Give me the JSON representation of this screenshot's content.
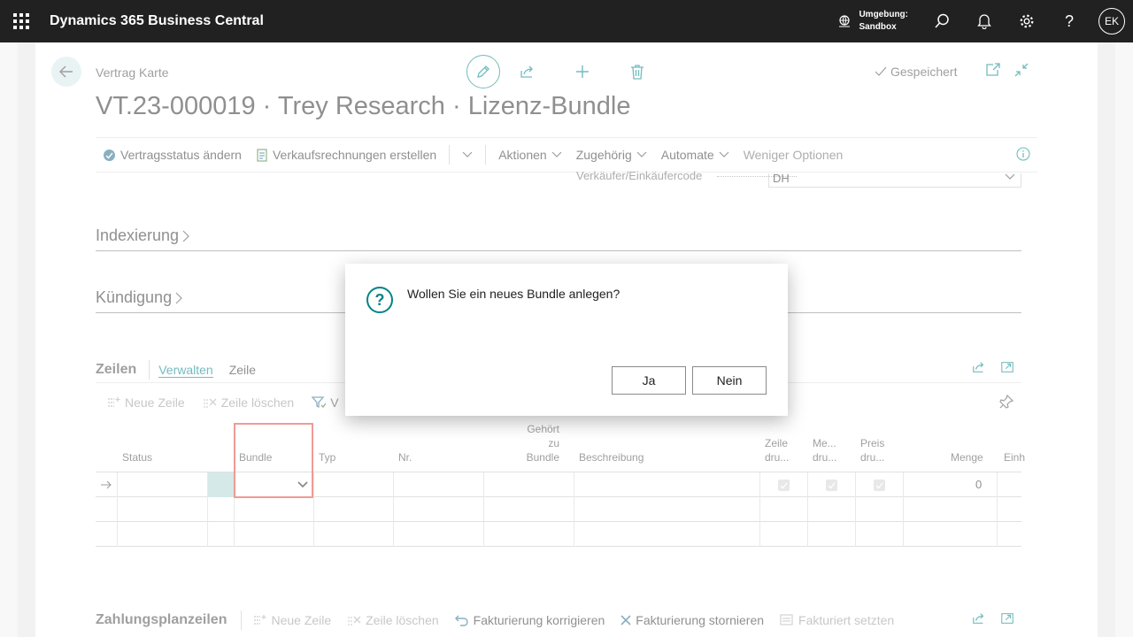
{
  "topbar": {
    "app_title": "Dynamics 365 Business Central",
    "env_label": "Umgebung:",
    "env_value": "Sandbox",
    "avatar_initials": "EK",
    "help_label": "?"
  },
  "header": {
    "breadcrumb": "Vertrag Karte",
    "saved_status": "Gespeichert",
    "title": "VT.23-000019 · Trey Research · Lizenz-Bundle"
  },
  "actionbar": {
    "change_status": "Vertragsstatus ändern",
    "create_invoices": "Verkaufsrechnungen erstellen",
    "actions": "Aktionen",
    "related": "Zugehörig",
    "automate": "Automate",
    "fewer_options": "Weniger Optionen"
  },
  "behind_field": {
    "label": "Verkäufer/Einkäufercode",
    "value": "DH"
  },
  "sections": {
    "indexing": "Indexierung",
    "termination": "Kündigung"
  },
  "lines": {
    "title": "Zeilen",
    "tab_manage": "Verwalten",
    "tab_line": "Zeile",
    "new_line": "Neue Zeile",
    "delete_line": "Zeile löschen",
    "partial_action": "V",
    "columns": {
      "status": "Status",
      "bundle": "Bundle",
      "type": "Typ",
      "no": "Nr.",
      "belongs_to_bundle_1": "Gehört zu",
      "belongs_to_bundle_2": "Bundle",
      "description": "Beschreibung",
      "line_print_1": "Zeile",
      "line_print_2": "dru...",
      "qty_print_1": "Me...",
      "qty_print_2": "dru...",
      "price_print_1": "Preis",
      "price_print_2": "dru...",
      "quantity": "Menge",
      "unit": "Einh"
    },
    "row1_quantity": "0"
  },
  "payment_plan": {
    "title": "Zahlungsplanzeilen",
    "new_line": "Neue Zeile",
    "delete_line": "Zeile löschen",
    "correct_invoicing": "Fakturierung korrigieren",
    "cancel_invoicing": "Fakturierung stornieren",
    "set_invoiced": "Fakturiert setzten"
  },
  "dialog": {
    "icon": "?",
    "message": "Wollen Sie ein neues Bundle anlegen?",
    "yes": "Ja",
    "no": "Nein"
  },
  "colors": {
    "accent": "#008489",
    "topbar": "#212121",
    "highlight": "#e04a3f"
  }
}
